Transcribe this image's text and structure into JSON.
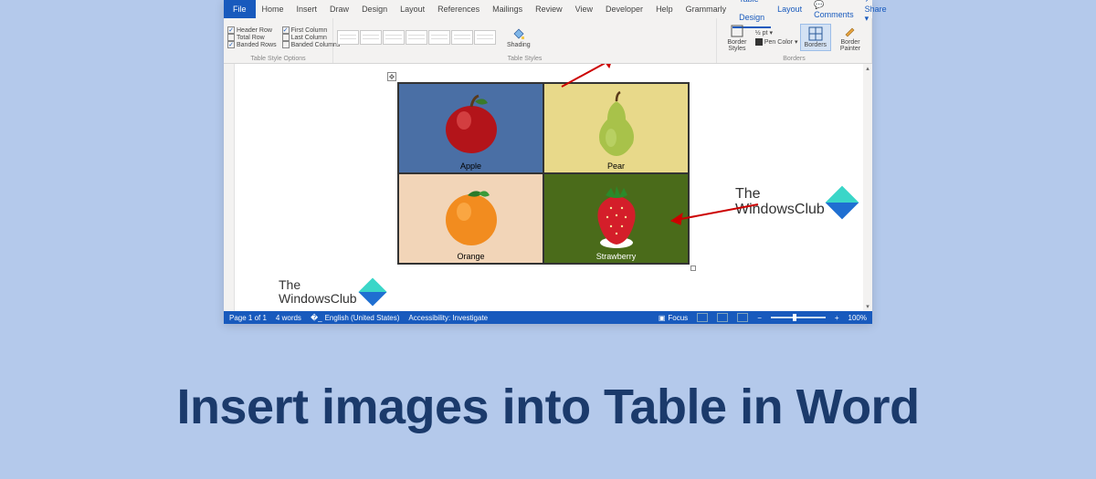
{
  "headline": "Insert images into Table in Word",
  "ribbon": {
    "file": "File",
    "tabs": [
      "Home",
      "Insert",
      "Draw",
      "Design",
      "Layout",
      "References",
      "Mailings",
      "Review",
      "View",
      "Developer",
      "Help",
      "Grammarly"
    ],
    "contextual": [
      "Table Design",
      "Layout"
    ],
    "active_contextual": "Table Design",
    "right": {
      "comments": "Comments",
      "share": "Share"
    },
    "groups": {
      "style_options": {
        "label": "Table Style Options",
        "checks": [
          {
            "label": "Header Row",
            "checked": true
          },
          {
            "label": "Total Row",
            "checked": false
          },
          {
            "label": "Banded Rows",
            "checked": true
          },
          {
            "label": "First Column",
            "checked": true
          },
          {
            "label": "Last Column",
            "checked": false
          },
          {
            "label": "Banded Columns",
            "checked": false
          }
        ]
      },
      "table_styles": {
        "label": "Table Styles"
      },
      "shading": {
        "label": "Shading"
      },
      "borders": {
        "label": "Borders",
        "border_styles": "Border\nStyles",
        "line_weight": "½ pt",
        "pen_color": "Pen Color",
        "borders_btn": "Borders",
        "border_painter": "Border\nPainter"
      }
    }
  },
  "table_cells": {
    "apple": "Apple",
    "pear": "Pear",
    "orange": "Orange",
    "strawberry": "Strawberry"
  },
  "watermark": {
    "line1": "The",
    "line2": "WindowsClub"
  },
  "status": {
    "page": "Page 1 of 1",
    "words": "4 words",
    "language": "English (United States)",
    "accessibility": "Accessibility: Investigate",
    "focus": "Focus",
    "zoom": "100%"
  },
  "icons": {
    "comment": "💬",
    "share": "↗",
    "checkbox_check": "✓",
    "dropdown": "▾",
    "scroll_up": "▴",
    "scroll_down": "▾",
    "move_handle": "✥",
    "minus": "−",
    "plus": "+"
  }
}
